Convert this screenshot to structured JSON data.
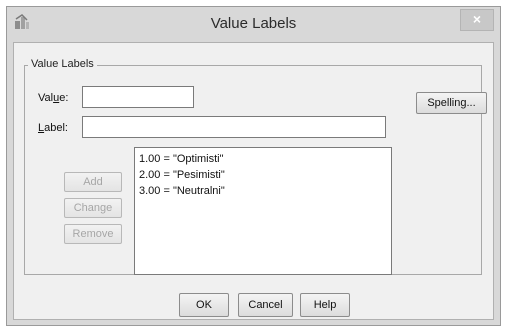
{
  "window": {
    "title": "Value Labels",
    "close_glyph": "×",
    "app_icon": "spss-app-icon"
  },
  "group": {
    "legend": "Value Labels"
  },
  "value_field": {
    "label_prefix": "Val",
    "label_mnemonic": "u",
    "label_suffix": "e:",
    "value": ""
  },
  "label_field": {
    "label_mnemonic": "L",
    "label_suffix": "abel:",
    "value": ""
  },
  "buttons": {
    "spelling": "Spelling...",
    "add": "Add",
    "change": "Change",
    "remove": "Remove",
    "ok": "OK",
    "cancel": "Cancel",
    "help": "Help"
  },
  "labels_list": [
    "1.00 = \"Optimisti\"",
    "2.00 = \"Pesimisti\"",
    "3.00 = \"Neutralni\""
  ]
}
